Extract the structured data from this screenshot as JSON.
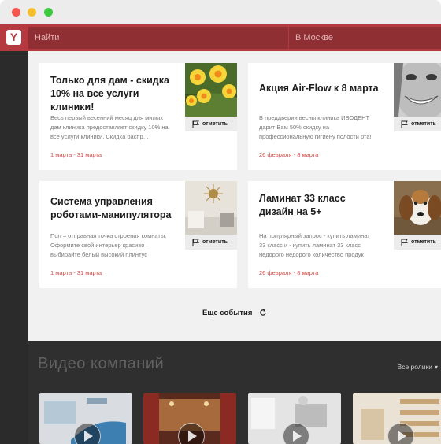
{
  "header": {
    "search_placeholder": "Найти",
    "city_placeholder": "В Москве",
    "logo_letter": "Y"
  },
  "events": [
    {
      "title": "Только для дам - скидка\n10% на все услуги клиники!",
      "description": "Весь первый весенний месяц для милых дам клиника предоставляет скидку 10% на все услуги клиники. Скидка распр…",
      "date": "1 марта - 31 марта",
      "mark_label": "отметить",
      "photo": "flowers"
    },
    {
      "title": "Акция Air-Flow к 8 марта",
      "description": "В преддверии весны клиника ИВОДЕНТ дарит Вам 50% скидку на профессиональную гигиену полости рта!",
      "date": "26 февраля - 8 марта",
      "mark_label": "отметить",
      "photo": "smile"
    },
    {
      "title": "Система управления\nроботами-манипулятора",
      "description": "Пол – отправная точка строения комнаты. Оформите свой интерьер красиво – выбирайте белый высокий плинтус",
      "date": "1 марта - 31 марта",
      "mark_label": "отметить",
      "photo": "interior"
    },
    {
      "title": "Ламинат 33 класс\nдизайн на 5+",
      "description": "На популярный запрос - купить ламинат 33 класс и - купить ламинат 33 класс недорого недорого количество продук",
      "date": "26 февраля - 8 марта",
      "mark_label": "отметить",
      "photo": "dog"
    }
  ],
  "more_events_label": "Еще события",
  "video": {
    "title": "Видео компаний",
    "all_link": "Все ролики",
    "thumbs": [
      "dental-chair",
      "stage",
      "dental-office",
      "wood-shelves"
    ]
  },
  "colors": {
    "brand": "#b53a3f",
    "date": "#d64848",
    "sidebar": "#2b2b2b",
    "video_bg": "#2f2f2f"
  }
}
